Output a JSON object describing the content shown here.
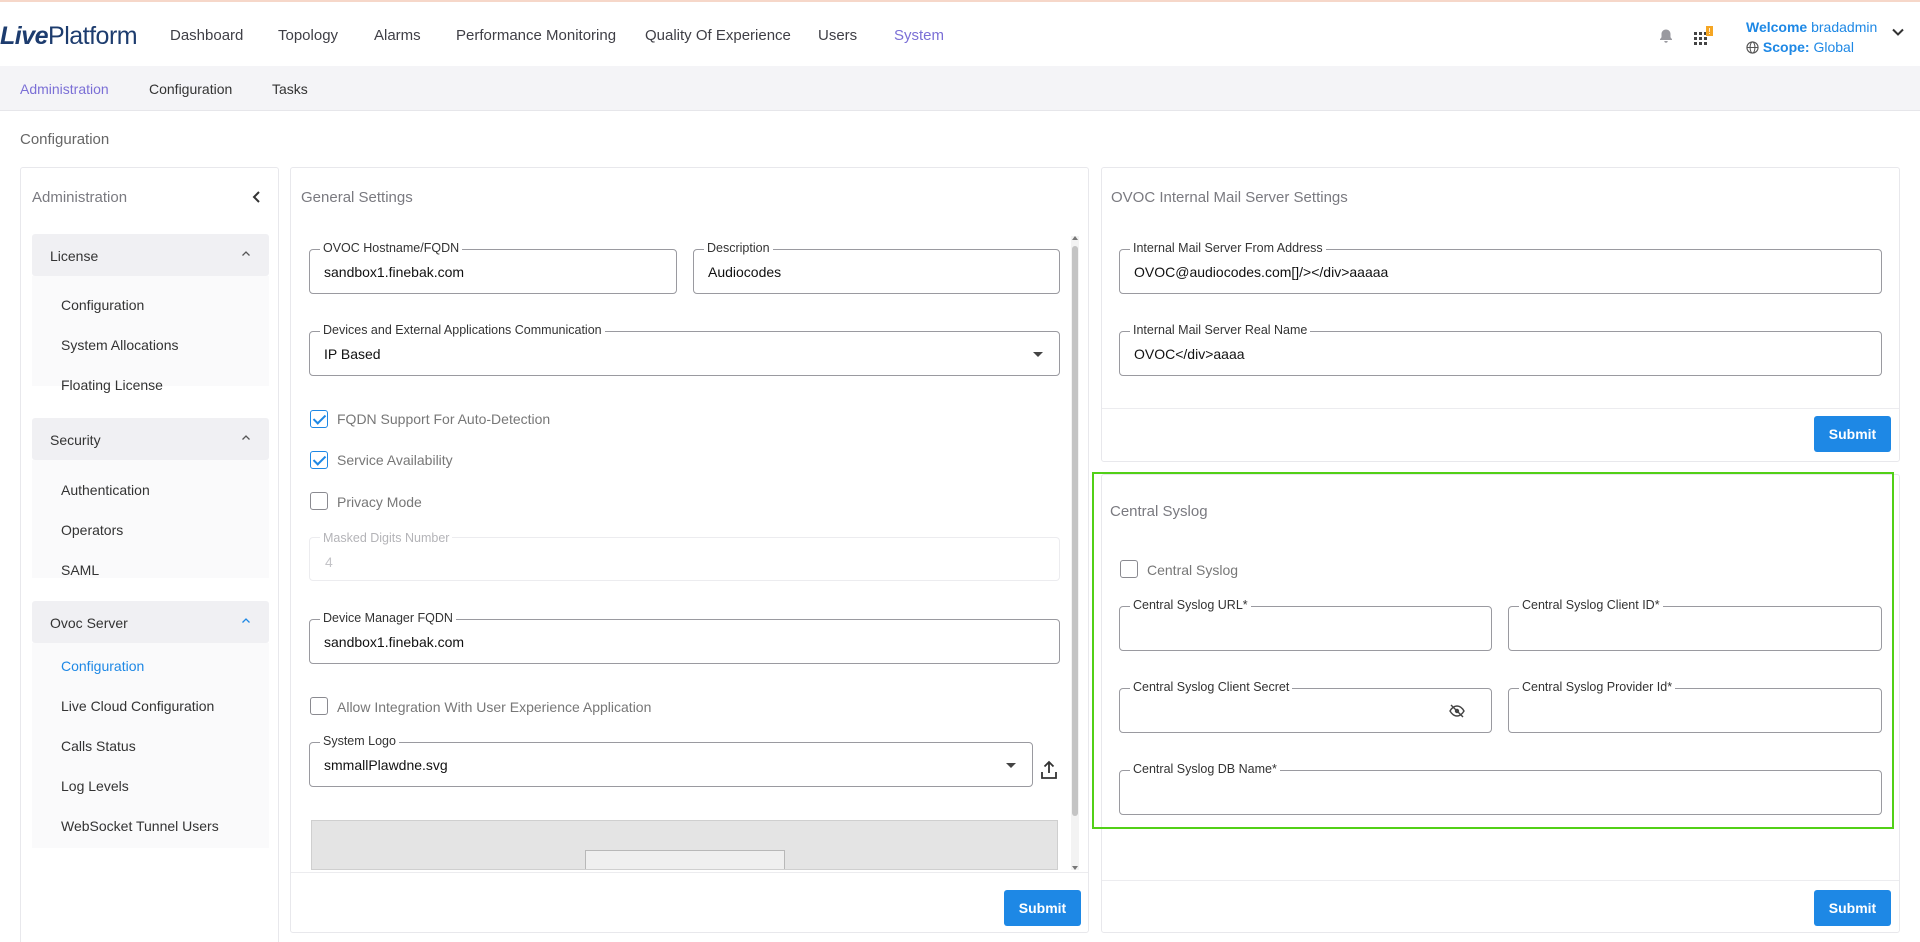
{
  "brand": {
    "live": "Live",
    "platform": "Platform"
  },
  "nav": {
    "items": [
      "Dashboard",
      "Topology",
      "Alarms",
      "Performance Monitoring",
      "Quality Of Experience",
      "Users",
      "System"
    ],
    "active": "System"
  },
  "header": {
    "welcome_label": "Welcome",
    "username": "bradadmin",
    "scope_label": "Scope:",
    "scope_value": "Global",
    "notification_badge": "!"
  },
  "subnav": {
    "items": [
      "Administration",
      "Configuration",
      "Tasks"
    ],
    "active": "Administration"
  },
  "page_title": "Configuration",
  "sidebar": {
    "title": "Administration",
    "groups": [
      {
        "label": "License",
        "items": [
          "Configuration",
          "System Allocations",
          "Floating License"
        ]
      },
      {
        "label": "Security",
        "items": [
          "Authentication",
          "Operators",
          "SAML"
        ]
      },
      {
        "label": "Ovoc Server",
        "items": [
          "Configuration",
          "Live Cloud Configuration",
          "Calls Status",
          "Log Levels",
          "WebSocket Tunnel Users"
        ]
      }
    ],
    "active_item": "Configuration"
  },
  "general": {
    "title": "General Settings",
    "hostname_label": "OVOC Hostname/FQDN",
    "hostname_value": "sandbox1.finebak.com",
    "description_label": "Description",
    "description_value": "Audiocodes",
    "comm_label": "Devices and External Applications Communication",
    "comm_value": "IP Based",
    "fqdn_support_label": "FQDN Support For Auto-Detection",
    "service_availability_label": "Service Availability",
    "privacy_mode_label": "Privacy Mode",
    "masked_digits_label": "Masked Digits Number",
    "masked_digits_value": "4",
    "device_manager_label": "Device Manager FQDN",
    "device_manager_value": "sandbox1.finebak.com",
    "allow_integration_label": "Allow Integration With User Experience Application",
    "system_logo_label": "System Logo",
    "system_logo_value": "smmallPlawdne.svg",
    "submit_label": "Submit"
  },
  "mail": {
    "title": "OVOC Internal Mail Server Settings",
    "from_label": "Internal Mail Server From Address",
    "from_value": "OVOC@audiocodes.com[]/></div>aaaaa",
    "name_label": "Internal Mail Server Real Name",
    "name_value": "OVOC</div>aaaa",
    "submit_label": "Submit"
  },
  "syslog": {
    "title": "Central Syslog",
    "checkbox_label": "Central Syslog",
    "url_label": "Central Syslog URL*",
    "client_id_label": "Central Syslog Client ID*",
    "client_secret_label": "Central Syslog Client Secret",
    "provider_id_label": "Central Syslog Provider Id*",
    "db_name_label": "Central Syslog DB Name*",
    "submit_label": "Submit"
  },
  "colors": {
    "accent": "#1e88e5",
    "active_nav": "#7b6fd6",
    "highlight": "#52d017"
  }
}
